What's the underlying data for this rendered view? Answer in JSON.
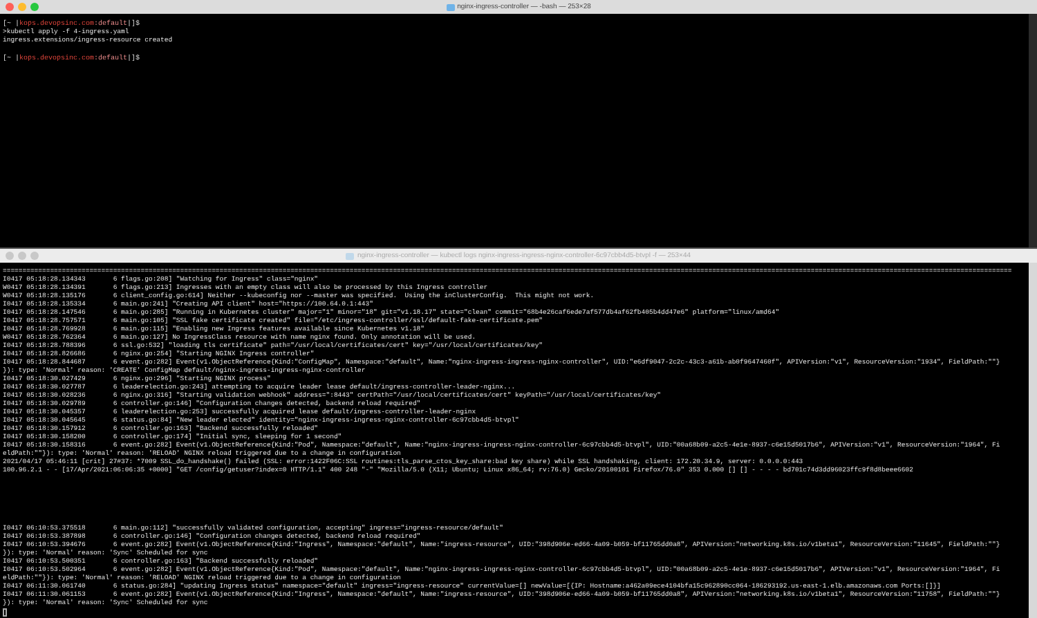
{
  "windows": [
    {
      "title": "nginx-ingress-controller — -bash — 253×28",
      "active": true,
      "lines": [
        {
          "kind": "prompt",
          "segments": [
            {
              "kind": "plain",
              "text": "[~ |"
            },
            {
              "kind": "host",
              "text": "kops.devopsinc.com"
            },
            {
              "kind": "context",
              "text": ":default"
            },
            {
              "kind": "plain",
              "text": "|]$"
            }
          ]
        },
        {
          "kind": "output",
          "text": ">kubectl apply -f 4-ingress.yaml"
        },
        {
          "kind": "output",
          "text": "ingress.extensions/ingress-resource created"
        },
        {
          "kind": "blank"
        },
        {
          "kind": "prompt",
          "segments": [
            {
              "kind": "plain",
              "text": "[~ |"
            },
            {
              "kind": "host",
              "text": "kops.devopsinc.com"
            },
            {
              "kind": "context",
              "text": ":default"
            },
            {
              "kind": "plain",
              "text": "|]$"
            }
          ]
        }
      ]
    },
    {
      "title": "nginx-ingress-controller — kubectl logs nginx-ingress-ingress-nginx-controller-6c97cbb4d5-btvpl -f — 253×44",
      "active": false,
      "lines": [
        {
          "kind": "output",
          "text": "================================================================================================================================================================================================================================================================"
        },
        {
          "kind": "output",
          "text": "I0417 05:18:28.134343       6 flags.go:208] \"Watching for Ingress\" class=\"nginx\""
        },
        {
          "kind": "output",
          "text": "W0417 05:18:28.134391       6 flags.go:213] Ingresses with an empty class will also be processed by this Ingress controller"
        },
        {
          "kind": "output",
          "text": "W0417 05:18:28.135176       6 client_config.go:614] Neither --kubeconfig nor --master was specified.  Using the inClusterConfig.  This might not work."
        },
        {
          "kind": "output",
          "text": "I0417 05:18:28.135334       6 main.go:241] \"Creating API client\" host=\"https://100.64.0.1:443\""
        },
        {
          "kind": "output",
          "text": "I0417 05:18:28.147546       6 main.go:285] \"Running in Kubernetes cluster\" major=\"1\" minor=\"18\" git=\"v1.18.17\" state=\"clean\" commit=\"68b4e26caf6ede7af577db4af62fb405b4dd47e6\" platform=\"linux/amd64\""
        },
        {
          "kind": "output",
          "text": "I0417 05:18:28.757571       6 main.go:105] \"SSL fake certificate created\" file=\"/etc/ingress-controller/ssl/default-fake-certificate.pem\""
        },
        {
          "kind": "output",
          "text": "I0417 05:18:28.769928       6 main.go:115] \"Enabling new Ingress features available since Kubernetes v1.18\""
        },
        {
          "kind": "output",
          "text": "W0417 05:18:28.762364       6 main.go:127] No IngressClass resource with name nginx found. Only annotation will be used."
        },
        {
          "kind": "output",
          "text": "I0417 05:18:28.788396       6 ssl.go:532] \"loading tls certificate\" path=\"/usr/local/certificates/cert\" key=\"/usr/local/certificates/key\""
        },
        {
          "kind": "output",
          "text": "I0417 05:18:28.826686       6 nginx.go:254] \"Starting NGINX Ingress controller\""
        },
        {
          "kind": "output",
          "text": "I0417 05:18:28.844687       6 event.go:282] Event(v1.ObjectReference{Kind:\"ConfigMap\", Namespace:\"default\", Name:\"nginx-ingress-ingress-nginx-controller\", UID:\"e6df9047-2c2c-43c3-a61b-ab0f9647460f\", APIVersion:\"v1\", ResourceVersion:\"1934\", FieldPath:\"\"}"
        },
        {
          "kind": "output",
          "text": "}): type: 'Normal' reason: 'CREATE' ConfigMap default/nginx-ingress-ingress-nginx-controller"
        },
        {
          "kind": "output",
          "text": "I0417 05:18:30.027429       6 nginx.go:296] \"Starting NGINX process\""
        },
        {
          "kind": "output",
          "text": "I0417 05:18:30.027787       6 leaderelection.go:243] attempting to acquire leader lease default/ingress-controller-leader-nginx..."
        },
        {
          "kind": "output",
          "text": "I0417 05:18:30.028236       6 nginx.go:316] \"Starting validation webhook\" address=\":8443\" certPath=\"/usr/local/certificates/cert\" keyPath=\"/usr/local/certificates/key\""
        },
        {
          "kind": "output",
          "text": "I0417 05:18:30.029789       6 controller.go:146] \"Configuration changes detected, backend reload required\""
        },
        {
          "kind": "output",
          "text": "I0417 05:18:30.045357       6 leaderelection.go:253] successfully acquired lease default/ingress-controller-leader-nginx"
        },
        {
          "kind": "output",
          "text": "I0417 05:18:30.045645       6 status.go:84] \"New leader elected\" identity=\"nginx-ingress-ingress-nginx-controller-6c97cbb4d5-btvpl\""
        },
        {
          "kind": "output",
          "text": "I0417 05:18:30.157912       6 controller.go:163] \"Backend successfully reloaded\""
        },
        {
          "kind": "output",
          "text": "I0417 05:18:30.158200       6 controller.go:174] \"Initial sync, sleeping for 1 second\""
        },
        {
          "kind": "output",
          "text": "I0417 05:18:30.158316       6 event.go:282] Event(v1.ObjectReference{Kind:\"Pod\", Namespace:\"default\", Name:\"nginx-ingress-ingress-nginx-controller-6c97cbb4d5-btvpl\", UID:\"00a68b09-a2c5-4e1e-8937-c6e15d5017b6\", APIVersion:\"v1\", ResourceVersion:\"1964\", Fi"
        },
        {
          "kind": "output",
          "text": "eldPath:\"\"}): type: 'Normal' reason: 'RELOAD' NGINX reload triggered due to a change in configuration"
        },
        {
          "kind": "output",
          "text": "2021/04/17 05:46:11 [crit] 27#37: *7009 SSL_do_handshake() failed (SSL: error:1422F06C:SSL routines:tls_parse_ctos_key_share:bad key share) while SSL handshaking, client: 172.20.34.9, server: 0.0.0.0:443"
        },
        {
          "kind": "output",
          "text": "100.96.2.1 - - [17/Apr/2021:06:06:35 +0000] \"GET /config/getuser?index=0 HTTP/1.1\" 400 248 \"-\" \"Mozilla/5.0 (X11; Ubuntu; Linux x86_64; rv:76.0) Gecko/20100101 Firefox/76.0\" 353 0.000 [] [] - - - - bd701c74d3dd96023ffc9f8d8beee6602"
        },
        {
          "kind": "blank"
        },
        {
          "kind": "blank"
        },
        {
          "kind": "blank"
        },
        {
          "kind": "blank"
        },
        {
          "kind": "blank"
        },
        {
          "kind": "blank"
        },
        {
          "kind": "output",
          "text": "I0417 06:10:53.375518       6 main.go:112] \"successfully validated configuration, accepting\" ingress=\"ingress-resource/default\""
        },
        {
          "kind": "output",
          "text": "I0417 06:10:53.387898       6 controller.go:146] \"Configuration changes detected, backend reload required\""
        },
        {
          "kind": "output",
          "text": "I0417 06:10:53.394676       6 event.go:282] Event(v1.ObjectReference{Kind:\"Ingress\", Namespace:\"default\", Name:\"ingress-resource\", UID:\"398d906e-ed66-4a09-b059-bf11765dd0a8\", APIVersion:\"networking.k8s.io/v1beta1\", ResourceVersion:\"11645\", FieldPath:\"\"}"
        },
        {
          "kind": "output",
          "text": "}): type: 'Normal' reason: 'Sync' Scheduled for sync"
        },
        {
          "kind": "output",
          "text": "I0417 06:10:53.500351       6 controller.go:163] \"Backend successfully reloaded\""
        },
        {
          "kind": "output",
          "text": "I0417 06:10:53.502964       6 event.go:282] Event(v1.ObjectReference{Kind:\"Pod\", Namespace:\"default\", Name:\"nginx-ingress-ingress-nginx-controller-6c97cbb4d5-btvpl\", UID:\"00a68b09-a2c5-4e1e-8937-c6e15d5017b6\", APIVersion:\"v1\", ResourceVersion:\"1964\", Fi"
        },
        {
          "kind": "output",
          "text": "eldPath:\"\"}): type: 'Normal' reason: 'RELOAD' NGINX reload triggered due to a change in configuration"
        },
        {
          "kind": "output",
          "text": "I0417 06:11:30.061740       6 status.go:284] \"updating Ingress status\" namespace=\"default\" ingress=\"ingress-resource\" currentValue=[] newValue=[{IP: Hostname:a462a09ece4104bfa15c962890cc064-186293192.us-east-1.elb.amazonaws.com Ports:[]}]"
        },
        {
          "kind": "output",
          "text": "I0417 06:11:30.061153       6 event.go:282] Event(v1.ObjectReference{Kind:\"Ingress\", Namespace:\"default\", Name:\"ingress-resource\", UID:\"398d906e-ed66-4a09-b059-bf11765dd0a8\", APIVersion:\"networking.k8s.io/v1beta1\", ResourceVersion:\"11758\", FieldPath:\"\"}"
        },
        {
          "kind": "output",
          "text": "}): type: 'Normal' reason: 'Sync' Scheduled for sync"
        },
        {
          "kind": "cursor"
        }
      ]
    }
  ]
}
